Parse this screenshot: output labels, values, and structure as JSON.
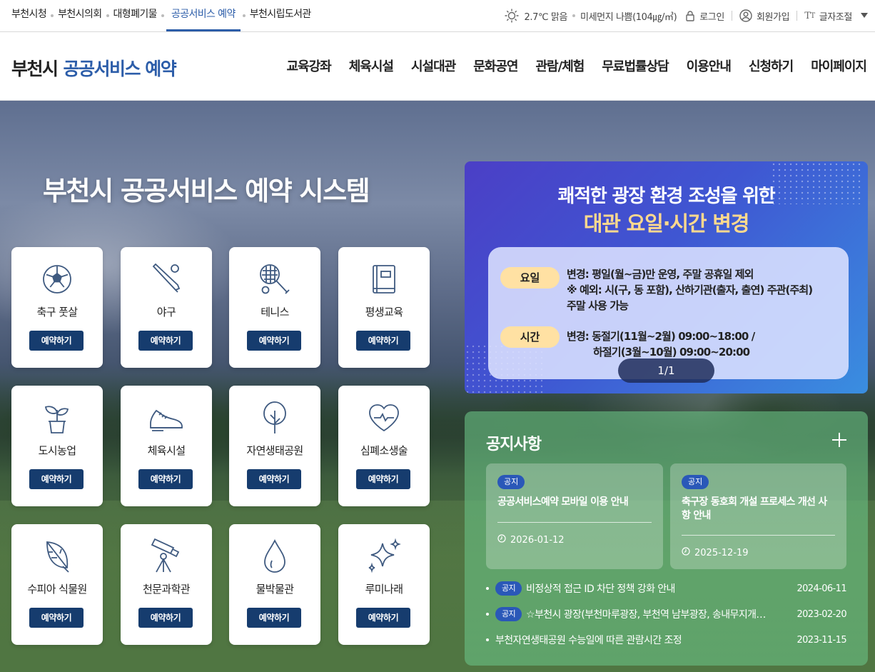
{
  "topbar": {
    "sites": [
      "부천시청",
      "부천시의회",
      "대형폐기물",
      "공공서비스 예약",
      "부천시립도서관"
    ],
    "weather": "2.7℃ 맑음",
    "dust": "미세먼지 나쁨(104㎍/㎥)",
    "login": "로그인",
    "signup": "회원가입",
    "font_size": "글자조절"
  },
  "header": {
    "logo_city": "부천시",
    "logo_service": "공공서비스 예약",
    "nav": [
      "교육강좌",
      "체육시설",
      "시설대관",
      "문화공연",
      "관람/체험",
      "무료법률상담",
      "이용안내",
      "신청하기",
      "마이페이지"
    ]
  },
  "hero": {
    "title": "부천시 공공서비스 예약 시스템",
    "reserve_label": "예약하기",
    "services": [
      {
        "name": "축구 풋살",
        "icon": "soccer-ball-icon"
      },
      {
        "name": "야구",
        "icon": "baseball-bat-icon"
      },
      {
        "name": "테니스",
        "icon": "tennis-racket-icon"
      },
      {
        "name": "평생교육",
        "icon": "book-icon"
      },
      {
        "name": "도시농업",
        "icon": "plant-pot-icon"
      },
      {
        "name": "체육시설",
        "icon": "sneaker-icon"
      },
      {
        "name": "자연생태공원",
        "icon": "tree-icon"
      },
      {
        "name": "심폐소생술",
        "icon": "heart-pulse-icon"
      },
      {
        "name": "수피아 식물원",
        "icon": "leaf-icon"
      },
      {
        "name": "천문과학관",
        "icon": "telescope-icon"
      },
      {
        "name": "물박물관",
        "icon": "water-drop-icon"
      },
      {
        "name": "루미나래",
        "icon": "sparkle-icon"
      }
    ]
  },
  "banner": {
    "title_line1": "쾌적한 광장 환경 조성을 위한",
    "title_line2": "대관 요일·시간 변경",
    "day_tag": "요일",
    "day_text1": "변경: 평일(월~금)만 운영, 주말 공휴일 제외",
    "day_text2": "※ 예외: 시(구, 동 포함), 산하기관(출자, 출연) 주관(주최)",
    "day_text3": "주말 사용 가능",
    "time_tag": "시간",
    "time_text1": "변경: 동절기(11월~2월) 09:00~18:00 /",
    "time_text2": "하절기(3월~10월) 09:00~20:00",
    "pager": "1/1"
  },
  "notice": {
    "title": "공지사항",
    "badge": "공지",
    "cards": [
      {
        "title": "공공서비스예약 모바일 이용 안내",
        "date": "2026-01-12"
      },
      {
        "title": "축구장 동호회 개설 프로세스 개선 사항 안내",
        "date": "2025-12-19"
      }
    ],
    "list": [
      {
        "badge": "공지",
        "title": "비정상적 접근 ID 차단 정책 강화 안내",
        "date": "2024-06-11"
      },
      {
        "badge": "공지",
        "title": "☆부천시 광장(부천마루광장, 부천역 남부광장, 송내무지개…",
        "date": "2023-02-20"
      },
      {
        "badge": "",
        "title": "부천자연생태공원 수능일에 따른 관람시간 조정",
        "date": "2023-11-15"
      }
    ]
  },
  "colors": {
    "brand": "#2c5da9",
    "button": "#163c6e",
    "badge": "#2a58b8",
    "banner_accent": "#ffd98e"
  }
}
